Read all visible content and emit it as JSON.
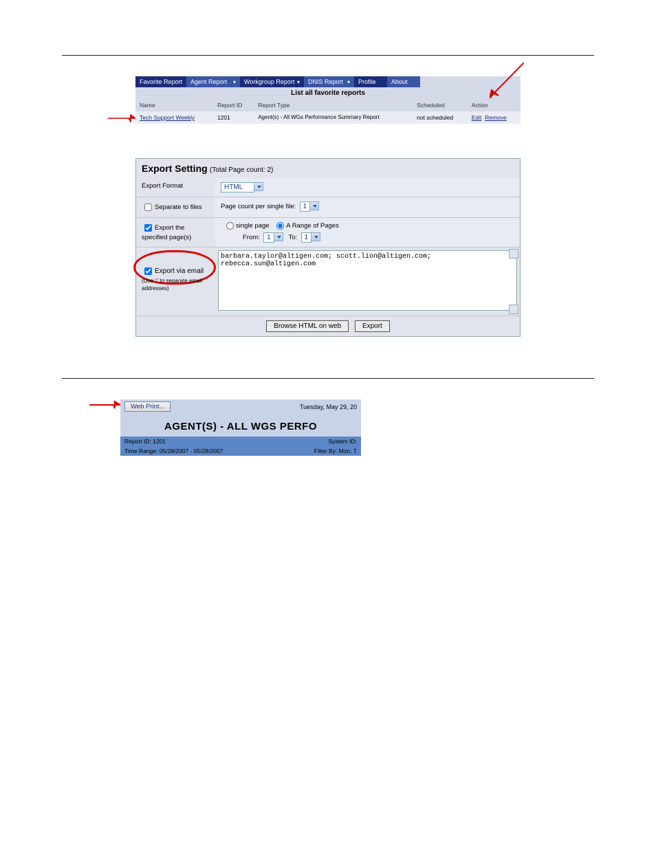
{
  "favoriteTabs": {
    "favorite": "Favorite Report",
    "agent": "Agent Report",
    "workgroup": "Workgroup Report",
    "dnis": "DNIS Report",
    "profile": "Profile",
    "about": "About"
  },
  "favoriteList": {
    "heading": "List all favorite reports",
    "cols": {
      "name": "Name",
      "reportId": "Report ID",
      "reportType": "Report Type",
      "scheduled": "Scheduled",
      "action": "Action"
    },
    "row": {
      "name": "Tech Support Weekly",
      "reportId": "1201",
      "reportType": "Agent(s) - All WGs Performance Summary Report",
      "scheduled": "not scheduled",
      "edit": "Edit",
      "remove": "Remove"
    }
  },
  "exportSetting": {
    "title": "Export Setting",
    "totalPage": "(Total Page count:    2)",
    "exportFormatLabel": "Export Format",
    "exportFormatValue": "HTML",
    "separateLabel": "Separate to files",
    "pageCountLabel": "Page count per single file:",
    "pageCountValue": "1",
    "exportSpecifiedLabel": "Export the specified page(s)",
    "singlePage": "single page",
    "rangePages": "A Range of Pages",
    "fromLabel": "From:",
    "fromValue": "1",
    "toLabel": "To:",
    "toValue": "1",
    "emailLabel1": "Export via email",
    "emailLabel2": "(Use ';' to separate email addresses)",
    "emailBody": "barbara.taylor@altigen.com; scott.lion@altigen.com; rebecca.sun@altigen.com",
    "browseBtn": "Browse HTML on web",
    "exportBtn": "Export"
  },
  "preview": {
    "webPrint": "Web Print...",
    "date": "Tuesday, May 29, 20",
    "title": "AGENT(S) - ALL WGS PERFO",
    "reportIdLabel": "Report ID: 1201",
    "systemIdLabel": "System ID:",
    "timeRangeLabel": "Time Range: 05/28/2007 - 05/28/2007",
    "filterByLabel": "Filter By: Mon, T"
  }
}
